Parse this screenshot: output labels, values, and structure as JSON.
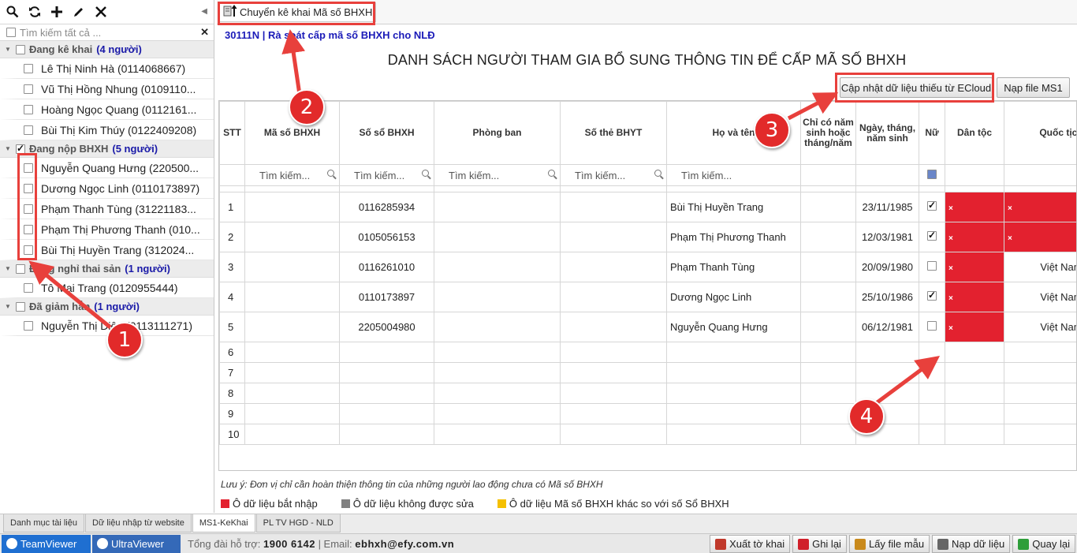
{
  "left_panel": {
    "search_placeholder": "Tìm kiếm tất cả ...",
    "groups": [
      {
        "label": "Đang kê khai",
        "count": "(4 người)",
        "checked": false,
        "people": [
          "Lê Thị Ninh Hà (0114068667)",
          "Vũ Thị Hồng Nhung (0109110...",
          "Hoàng Ngọc Quang (0112161...",
          "Bùi Thị Kim Thúy (0122409208)"
        ]
      },
      {
        "label": "Đang nộp BHXH",
        "count": "(5 người)",
        "checked": true,
        "people": [
          "Nguyễn Quang Hưng (220500...",
          "Dương Ngọc Linh (0110173897)",
          "Phạm Thanh Tùng (31221183...",
          "Phạm Thị Phương Thanh (010...",
          "Bùi Thị Huyền Trang (312024..."
        ]
      },
      {
        "label": "Đang nghỉ thai sản",
        "count": "(1 người)",
        "checked": false,
        "people": [
          "Tô Mai Trang (0120955444)"
        ]
      },
      {
        "label": "Đã giảm hẳn",
        "count": "(1 người)",
        "checked": false,
        "people": [
          "Nguyễn Thị Diệu (0113111271)"
        ]
      }
    ]
  },
  "toolbar": {
    "transfer_label": "Chuyển kê khai Mã số BHXH"
  },
  "header": {
    "subtitle": "30111N | Rà soát cấp mã số BHXH cho NLĐ",
    "title": "DANH SÁCH NGƯỜI THAM GIA BỔ SUNG THÔNG TIN ĐỂ CẤP MÃ SỐ BHXH",
    "update_button": "Cập nhật dữ liệu thiếu từ ECloud",
    "load_button": "Nạp file MS1"
  },
  "grid": {
    "columns": [
      "STT",
      "Mã số BHXH",
      "Số sổ BHXH",
      "Phòng ban",
      "Số thẻ BHYT",
      "Họ và tên",
      "Chỉ có năm sinh hoặc tháng/năm",
      "Ngày, tháng, năm sinh",
      "Nữ",
      "Dân tộc",
      "Quốc tịch"
    ],
    "filter_placeholder": "Tìm kiếm...",
    "rows": [
      {
        "stt": "1",
        "so_so": "0116285934",
        "ho_ten": "Bùi Thị Huyền Trang",
        "ngay_sinh": "23/11/1985",
        "nu": true,
        "dan_toc": "",
        "quoc_tich": ""
      },
      {
        "stt": "2",
        "so_so": "0105056153",
        "ho_ten": "Phạm Thị Phương Thanh",
        "ngay_sinh": "12/03/1981",
        "nu": true,
        "dan_toc": "",
        "quoc_tich": ""
      },
      {
        "stt": "3",
        "so_so": "0116261010",
        "ho_ten": "Phạm Thanh Tùng",
        "ngay_sinh": "20/09/1980",
        "nu": false,
        "dan_toc": "",
        "quoc_tich": "Việt Nam"
      },
      {
        "stt": "4",
        "so_so": "0110173897",
        "ho_ten": "Dương Ngọc Linh",
        "ngay_sinh": "25/10/1986",
        "nu": true,
        "dan_toc": "",
        "quoc_tich": "Việt Nam"
      },
      {
        "stt": "5",
        "so_so": "2205004980",
        "ho_ten": "Nguyễn Quang Hưng",
        "ngay_sinh": "06/12/1981",
        "nu": false,
        "dan_toc": "",
        "quoc_tich": "Việt Nam"
      }
    ],
    "empty_rows": [
      "6",
      "7",
      "8",
      "9",
      "10"
    ]
  },
  "note": "Lưu ý: Đơn vị chỉ cần hoàn thiện thông tin của những người lao động chưa có Mã số BHXH",
  "legend": [
    {
      "label": "Ô dữ liệu bắt nhập",
      "color": "#e3212f"
    },
    {
      "label": "Ô dữ liệu không được sửa",
      "color": "#808080"
    },
    {
      "label": "Ô dữ liệu Mã số BHXH khác so với số Sổ BHXH",
      "color": "#f5c000"
    }
  ],
  "tabs": [
    "Danh mục tài liệu",
    "Dữ liệu nhập từ website",
    "MS1-KeKhai",
    "PL TV HGD - NLD"
  ],
  "active_tab": "MS1-KeKhai",
  "status": {
    "teamviewer": "TeamViewer",
    "ultraviewer": "UltraViewer",
    "support_label": "Tổng đài hỗ trợ:",
    "support_phone": "1900 6142",
    "email_label": "| Email:",
    "email": "ebhxh@efy.com.vn"
  },
  "actions": [
    {
      "label": "Xuất tờ khai",
      "icon": "export-icon",
      "color": "#c0392b"
    },
    {
      "label": "Ghi lại",
      "icon": "save-icon",
      "color": "#d0202a"
    },
    {
      "label": "Lấy file mẫu",
      "icon": "template-icon",
      "color": "#c98a1c"
    },
    {
      "label": "Nạp dữ liệu",
      "icon": "import-icon",
      "color": "#666666"
    },
    {
      "label": "Quay lại",
      "icon": "back-icon",
      "color": "#2e9e3a"
    }
  ],
  "annotations": [
    "1",
    "2",
    "3",
    "4"
  ],
  "colors": {
    "required_cell": "#e3212f",
    "annotation": "#e22a2a",
    "link_blue": "#1a1ab8"
  }
}
